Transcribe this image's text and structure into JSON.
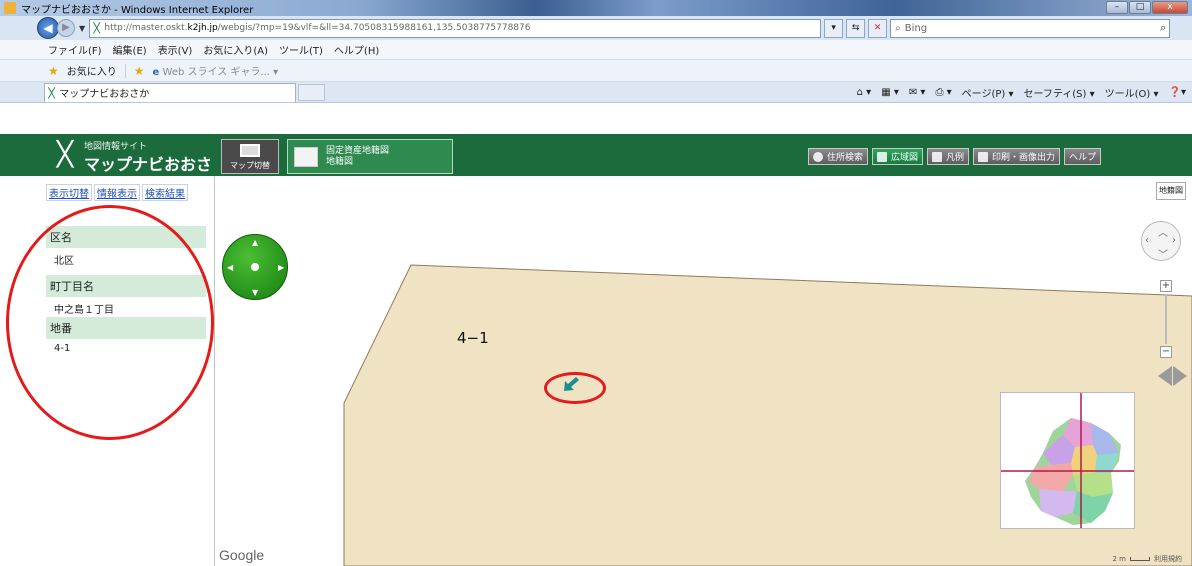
{
  "window": {
    "title": "マップナビおおさか - Windows Internet Explorer",
    "controls": [
      "–",
      "□",
      "x"
    ]
  },
  "address_bar": {
    "url_prefix": "http://master.oskt.",
    "url_host": "k2jh.jp",
    "url_rest": "/webgis/?mp=19&vlf=&ll=34.70508315988161,135.5038775778876",
    "search_placeholder": "Bing"
  },
  "menu": [
    "ファイル(F)",
    "編集(E)",
    "表示(V)",
    "お気に入り(A)",
    "ツール(T)",
    "ヘルプ(H)"
  ],
  "favorites_bar": {
    "favorites_label": "お気に入り",
    "webslice_label": "Web スライス ギャラ..."
  },
  "tab": {
    "label": "マップナビおおさか"
  },
  "command_bar": [
    "ページ(P) ▾",
    "セーフティ(S) ▾",
    "ツール(O) ▾"
  ],
  "app": {
    "logo_subtitle": "地図情報サイト",
    "logo_title": "マップナビおおさか",
    "map_switch_label": "マップ切替",
    "layer_line1": "固定資産地籍図",
    "layer_line2": "地籍図",
    "toolbar": {
      "address_search": "住所検索",
      "wide_map": "広域図",
      "legend": "凡例",
      "print": "印刷・画像出力",
      "help": "ヘルプ"
    }
  },
  "left_panel": {
    "tabs": [
      "表示切替",
      "情報表示",
      "検索結果"
    ],
    "sections": [
      {
        "header": "区名",
        "value": "北区"
      },
      {
        "header": "町丁目名",
        "value": "中之島１丁目"
      },
      {
        "header": "地番",
        "value": "4-1"
      }
    ]
  },
  "map": {
    "parcel_label": "4−1",
    "map_type_button": "地籍図",
    "google_label": "Google",
    "scale_label": "2 m",
    "terms_label": "利用規約",
    "colors": {
      "parcel_fill": "#f0e3c4",
      "parcel_stroke": "#8a7c5c",
      "marker": "#1a8f8f",
      "annotation": "#e31b1b",
      "header_green": "#1c6b3c"
    }
  }
}
